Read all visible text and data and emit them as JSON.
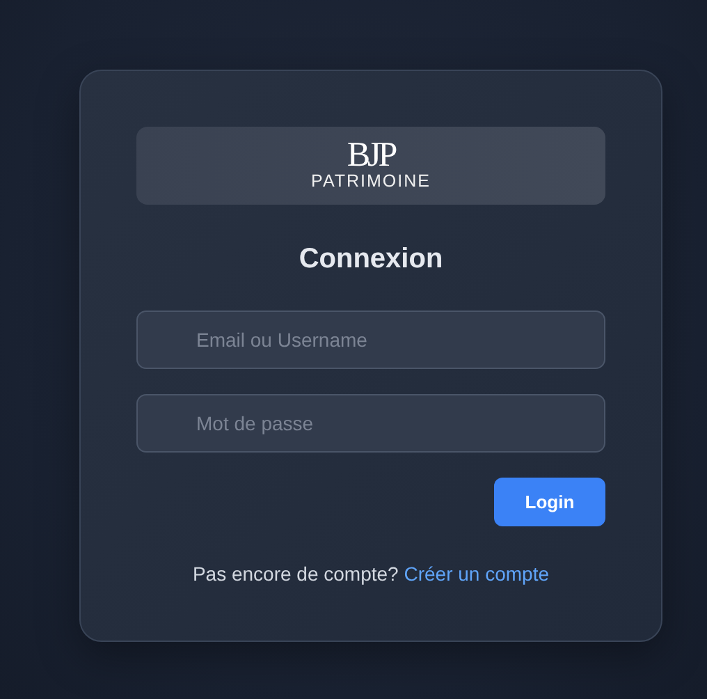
{
  "logo": {
    "mark": "BJP",
    "name": "PATRIMOINE"
  },
  "title": "Connexion",
  "fields": [
    {
      "placeholder": "Email ou Username"
    },
    {
      "placeholder": "Mot de passe"
    }
  ],
  "submit": "Login",
  "footer": {
    "prompt": "Pas encore de compte?",
    "link": "Créer un compte"
  }
}
